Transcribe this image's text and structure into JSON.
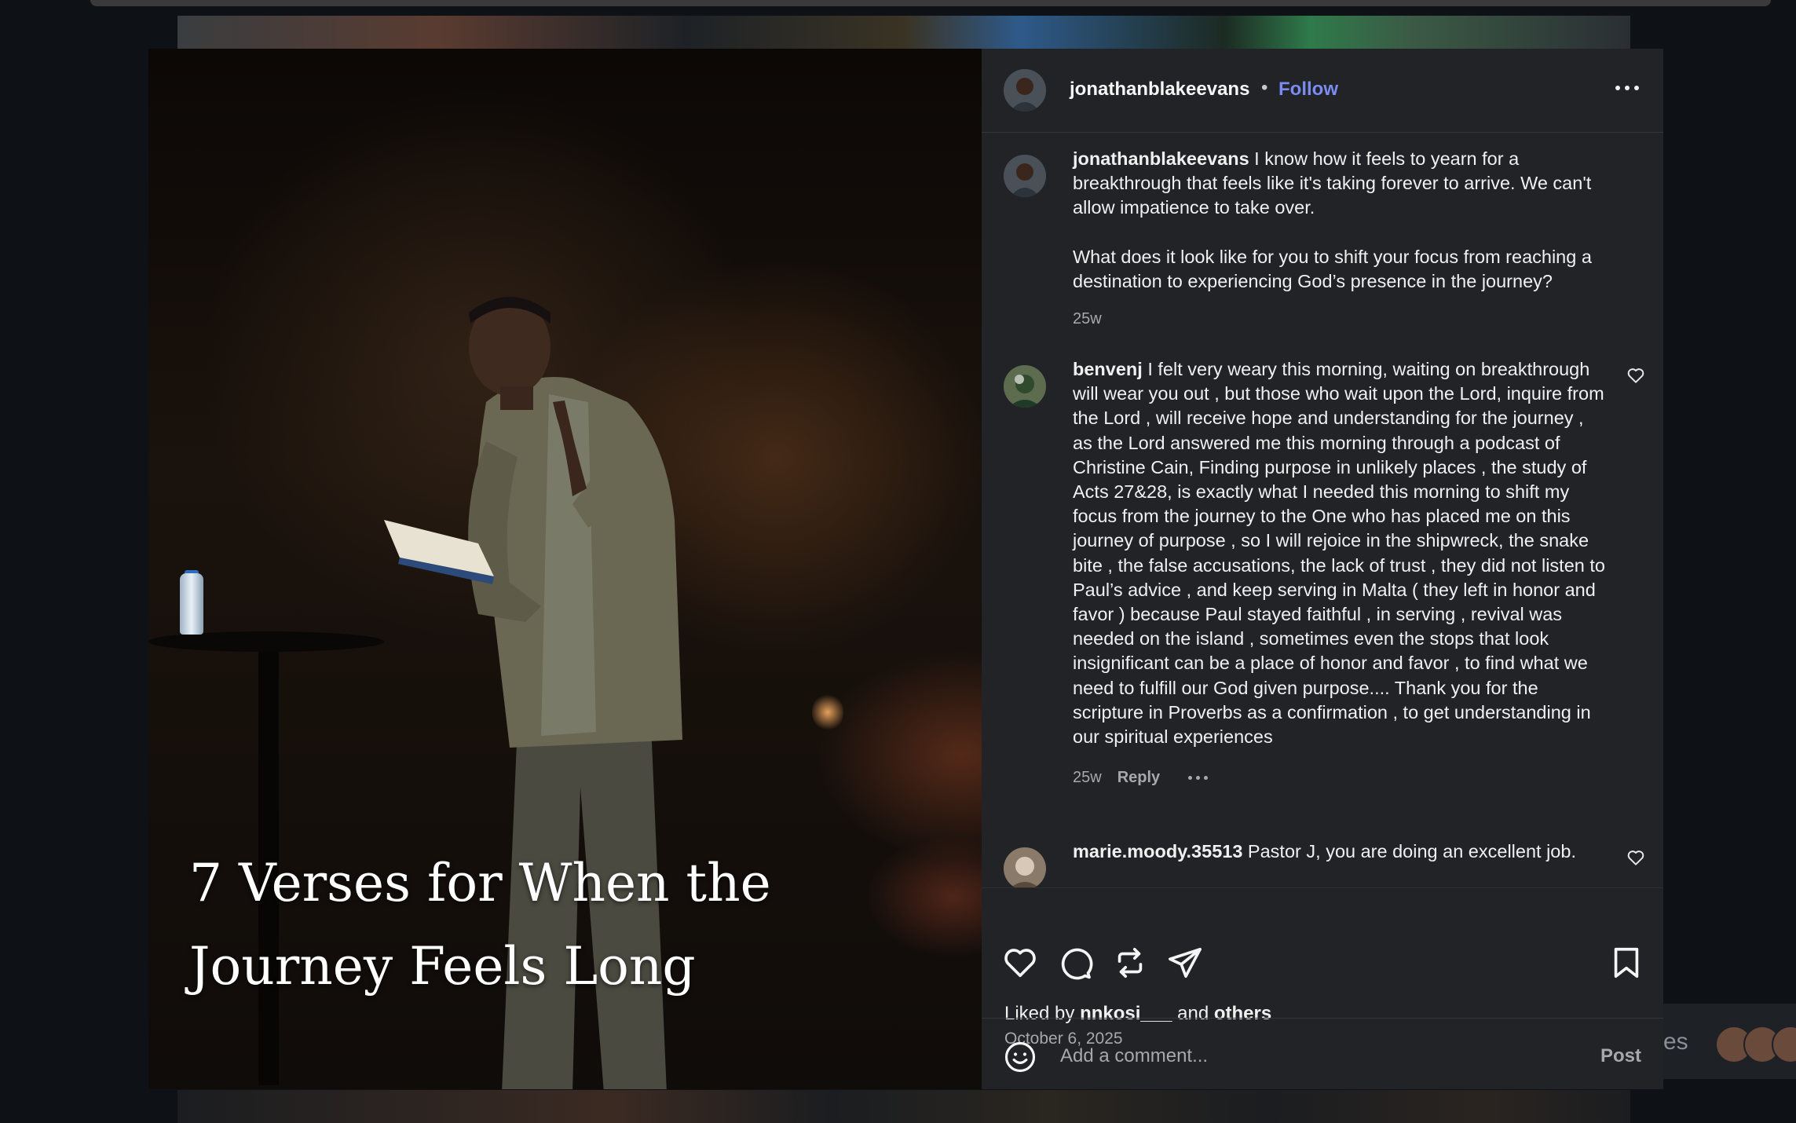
{
  "slide": {
    "title": "7 Verses for When the Journey Feels Long",
    "dot_count": 9,
    "active_dot": 0
  },
  "post": {
    "author": "jonathanblakeevans",
    "separator": "•",
    "follow_label": "Follow"
  },
  "caption": {
    "username": "jonathanblakeevans",
    "text": " I know how it feels to yearn for a breakthrough that feels like it's taking forever to arrive. We can't allow impatience to take over.\n\nWhat does it look like for you to shift your focus from reaching a destination to experiencing God’s presence in the journey?",
    "time": "25w"
  },
  "comments": [
    {
      "username": "benvenj",
      "text": " I felt very weary this morning, waiting on breakthrough will wear you out , but those who wait upon the Lord, inquire from the Lord , will receive hope and understanding for the journey , as the Lord answered me this morning through a podcast of Christine Cain, Finding purpose in unlikely places , the study of Acts 27&28, is exactly what I needed this morning to shift my focus from the journey to the One who has placed me on this journey of purpose , so I will rejoice in the shipwreck, the snake bite , the false accusations, the lack of trust , they did not listen to Paul’s advice , and keep serving in Malta ( they left in honor and favor ) because Paul stayed faithful , in serving , revival was needed on the island , sometimes even the stops that look insignificant can be a place of honor and favor , to find what we need to fulfill our God given purpose.... Thank you for the scripture in Proverbs as a confirmation , to get understanding in our spiritual experiences",
      "time": "25w",
      "reply_label": "Reply"
    },
    {
      "username": "marie.moody.35513",
      "text": " Pastor J, you are doing an excellent job."
    }
  ],
  "likes": {
    "prefix": "Liked by ",
    "user": "nnkosi___",
    "middle": " and ",
    "others": "others"
  },
  "post_date": "October 6, 2025",
  "composer": {
    "placeholder": "Add a comment...",
    "post_label": "Post"
  },
  "background": {
    "partial_text": "es"
  },
  "colors": {
    "panel": "#222327",
    "follow": "#7c8bf2",
    "page_bg": "#0e1116"
  }
}
